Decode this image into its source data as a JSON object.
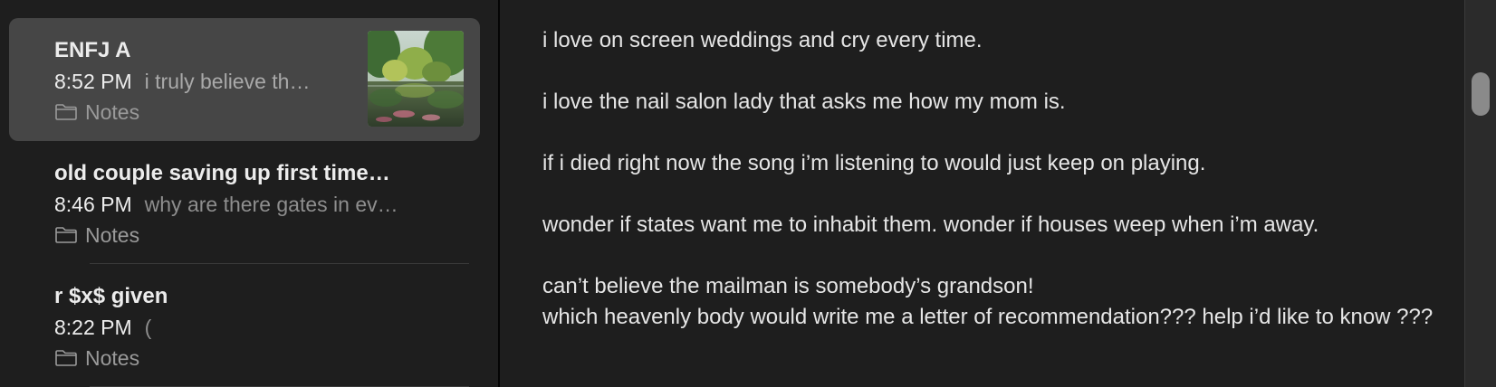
{
  "notes": [
    {
      "title": "ENFJ A",
      "time": "8:52 PM",
      "preview": "i truly believe th…",
      "folder": "Notes",
      "selected": true,
      "has_thumbnail": true
    },
    {
      "title": "old couple saving up first time…",
      "time": "8:46 PM",
      "preview": "why are there gates in ev…",
      "folder": "Notes",
      "selected": false,
      "has_thumbnail": false
    },
    {
      "title": "r $x$ given",
      "time": "8:22 PM",
      "preview": "(",
      "folder": "Notes",
      "selected": false,
      "has_thumbnail": false
    }
  ],
  "editor": {
    "lines": [
      "i love on screen weddings and cry every time.",
      "i love the nail salon lady that asks me how my mom is.",
      "if i died right now the song i’m listening to would just keep on playing.",
      "wonder if states want me to inhabit them. wonder if houses weep when i’m away.",
      "can’t believe the mailman is somebody’s grandson!",
      "which heavenly body would write me a letter of recommendation??? help i’d like to know ???"
    ]
  },
  "icons": {
    "folder": "folder-icon",
    "thumbnail": "pond-landscape-thumbnail"
  },
  "colors": {
    "background": "#1e1e1e",
    "selected_row": "#464646",
    "text_primary": "#e6e6e6",
    "text_secondary": "#8e8e8e"
  }
}
